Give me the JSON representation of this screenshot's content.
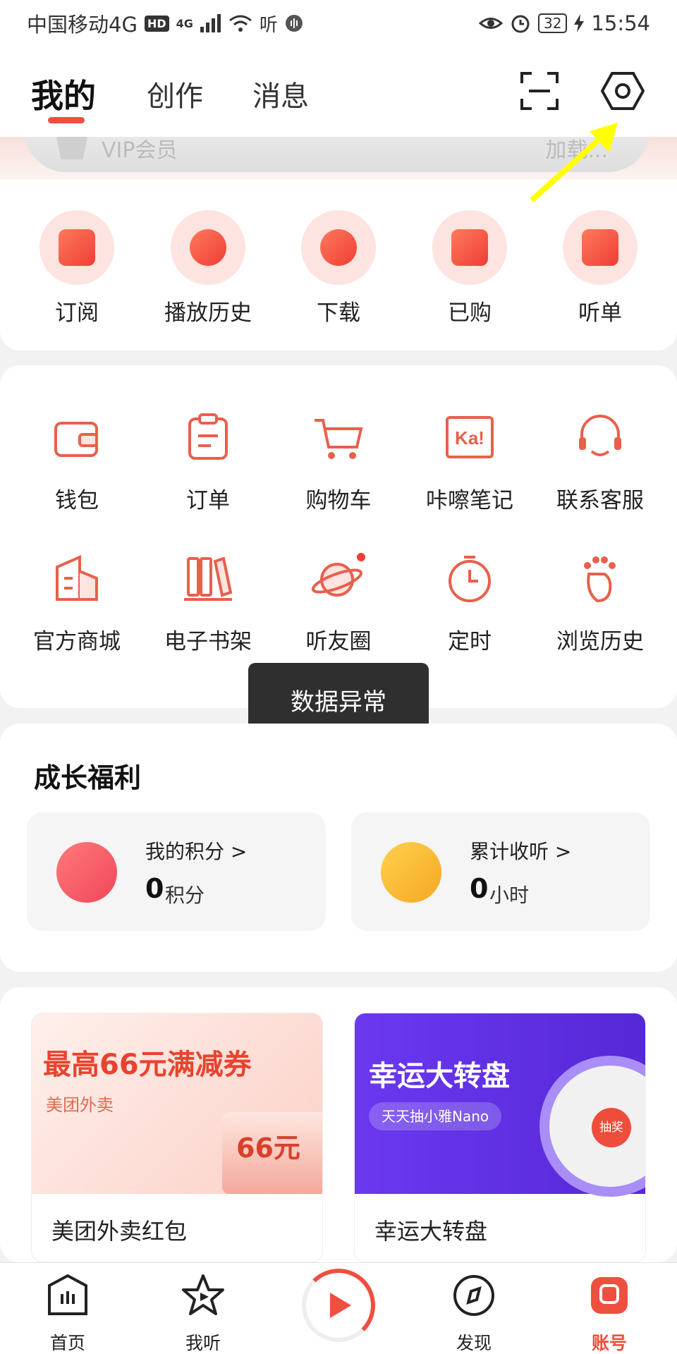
{
  "status_bar": {
    "carrier": "中国移动4G",
    "hd": "HD",
    "network": "4G",
    "listen_glyph": "听",
    "battery": "32",
    "time": "15:54"
  },
  "header": {
    "tabs": [
      {
        "label": "我的",
        "active": true
      },
      {
        "label": "创作",
        "active": false
      },
      {
        "label": "消息",
        "active": false
      }
    ],
    "icons": [
      "scan-icon",
      "settings-icon"
    ]
  },
  "vip": {
    "left": "VIP会员",
    "right": "加载..."
  },
  "quick_items": [
    {
      "label": "订阅",
      "icon": "subscribe-icon"
    },
    {
      "label": "播放历史",
      "icon": "history-icon"
    },
    {
      "label": "下载",
      "icon": "download-icon"
    },
    {
      "label": "已购",
      "icon": "purchased-icon"
    },
    {
      "label": "听单",
      "icon": "playlist-icon"
    }
  ],
  "grid_items": [
    {
      "label": "钱包",
      "icon": "wallet-icon"
    },
    {
      "label": "订单",
      "icon": "order-icon"
    },
    {
      "label": "购物车",
      "icon": "cart-icon"
    },
    {
      "label": "咔嚓笔记",
      "icon": "notes-icon"
    },
    {
      "label": "联系客服",
      "icon": "support-icon"
    },
    {
      "label": "官方商城",
      "icon": "mall-icon"
    },
    {
      "label": "电子书架",
      "icon": "bookshelf-icon"
    },
    {
      "label": "听友圈",
      "icon": "planet-icon"
    },
    {
      "label": "定时",
      "icon": "timer-icon"
    },
    {
      "label": "浏览历史",
      "icon": "footprint-icon"
    }
  ],
  "toast": "数据异常",
  "growth": {
    "title": "成长福利",
    "cards": [
      {
        "name": "我的积分 >",
        "value": "0",
        "unit": "积分",
        "color": "#f0475a"
      },
      {
        "name": "累计收听 >",
        "value": "0",
        "unit": "小时",
        "color": "#f5a623"
      }
    ]
  },
  "promos": [
    {
      "headline": "最高66元满减券",
      "sub": "美团外卖",
      "amount": "66元",
      "caption": "美团外卖红包"
    },
    {
      "headline": "幸运大转盘",
      "sub": "天天抽小雅Nano",
      "wheel_center": "抽奖",
      "caption": "幸运大转盘"
    }
  ],
  "bottom_nav": [
    {
      "label": "首页",
      "icon": "home-icon"
    },
    {
      "label": "我听",
      "icon": "star-play-icon"
    },
    {
      "label": "",
      "icon": "player-icon"
    },
    {
      "label": "发现",
      "icon": "discover-icon"
    },
    {
      "label": "账号",
      "icon": "account-icon",
      "active": true
    }
  ],
  "colors": {
    "accent": "#ef4f3f",
    "annotation": "#ffff00"
  }
}
